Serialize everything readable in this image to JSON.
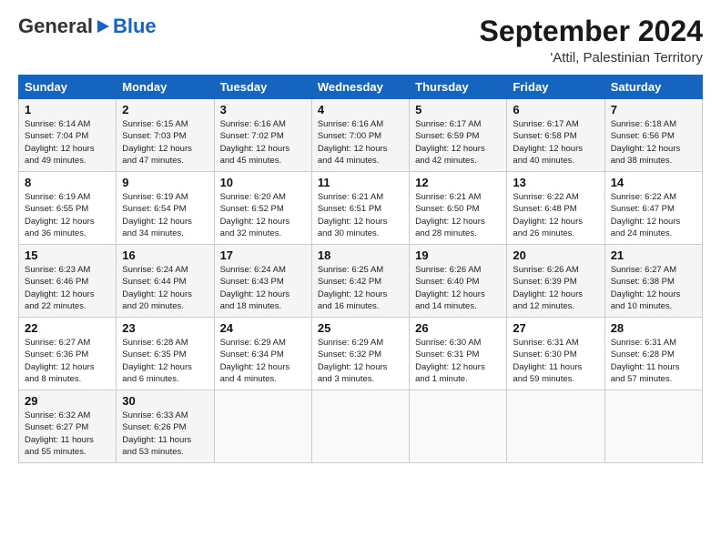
{
  "header": {
    "logo_general": "General",
    "logo_blue": "Blue",
    "month": "September 2024",
    "location": "'Attil, Palestinian Territory"
  },
  "days_of_week": [
    "Sunday",
    "Monday",
    "Tuesday",
    "Wednesday",
    "Thursday",
    "Friday",
    "Saturday"
  ],
  "weeks": [
    [
      {
        "day": "1",
        "info": "Sunrise: 6:14 AM\nSunset: 7:04 PM\nDaylight: 12 hours\nand 49 minutes."
      },
      {
        "day": "2",
        "info": "Sunrise: 6:15 AM\nSunset: 7:03 PM\nDaylight: 12 hours\nand 47 minutes."
      },
      {
        "day": "3",
        "info": "Sunrise: 6:16 AM\nSunset: 7:02 PM\nDaylight: 12 hours\nand 45 minutes."
      },
      {
        "day": "4",
        "info": "Sunrise: 6:16 AM\nSunset: 7:00 PM\nDaylight: 12 hours\nand 44 minutes."
      },
      {
        "day": "5",
        "info": "Sunrise: 6:17 AM\nSunset: 6:59 PM\nDaylight: 12 hours\nand 42 minutes."
      },
      {
        "day": "6",
        "info": "Sunrise: 6:17 AM\nSunset: 6:58 PM\nDaylight: 12 hours\nand 40 minutes."
      },
      {
        "day": "7",
        "info": "Sunrise: 6:18 AM\nSunset: 6:56 PM\nDaylight: 12 hours\nand 38 minutes."
      }
    ],
    [
      {
        "day": "8",
        "info": "Sunrise: 6:19 AM\nSunset: 6:55 PM\nDaylight: 12 hours\nand 36 minutes."
      },
      {
        "day": "9",
        "info": "Sunrise: 6:19 AM\nSunset: 6:54 PM\nDaylight: 12 hours\nand 34 minutes."
      },
      {
        "day": "10",
        "info": "Sunrise: 6:20 AM\nSunset: 6:52 PM\nDaylight: 12 hours\nand 32 minutes."
      },
      {
        "day": "11",
        "info": "Sunrise: 6:21 AM\nSunset: 6:51 PM\nDaylight: 12 hours\nand 30 minutes."
      },
      {
        "day": "12",
        "info": "Sunrise: 6:21 AM\nSunset: 6:50 PM\nDaylight: 12 hours\nand 28 minutes."
      },
      {
        "day": "13",
        "info": "Sunrise: 6:22 AM\nSunset: 6:48 PM\nDaylight: 12 hours\nand 26 minutes."
      },
      {
        "day": "14",
        "info": "Sunrise: 6:22 AM\nSunset: 6:47 PM\nDaylight: 12 hours\nand 24 minutes."
      }
    ],
    [
      {
        "day": "15",
        "info": "Sunrise: 6:23 AM\nSunset: 6:46 PM\nDaylight: 12 hours\nand 22 minutes."
      },
      {
        "day": "16",
        "info": "Sunrise: 6:24 AM\nSunset: 6:44 PM\nDaylight: 12 hours\nand 20 minutes."
      },
      {
        "day": "17",
        "info": "Sunrise: 6:24 AM\nSunset: 6:43 PM\nDaylight: 12 hours\nand 18 minutes."
      },
      {
        "day": "18",
        "info": "Sunrise: 6:25 AM\nSunset: 6:42 PM\nDaylight: 12 hours\nand 16 minutes."
      },
      {
        "day": "19",
        "info": "Sunrise: 6:26 AM\nSunset: 6:40 PM\nDaylight: 12 hours\nand 14 minutes."
      },
      {
        "day": "20",
        "info": "Sunrise: 6:26 AM\nSunset: 6:39 PM\nDaylight: 12 hours\nand 12 minutes."
      },
      {
        "day": "21",
        "info": "Sunrise: 6:27 AM\nSunset: 6:38 PM\nDaylight: 12 hours\nand 10 minutes."
      }
    ],
    [
      {
        "day": "22",
        "info": "Sunrise: 6:27 AM\nSunset: 6:36 PM\nDaylight: 12 hours\nand 8 minutes."
      },
      {
        "day": "23",
        "info": "Sunrise: 6:28 AM\nSunset: 6:35 PM\nDaylight: 12 hours\nand 6 minutes."
      },
      {
        "day": "24",
        "info": "Sunrise: 6:29 AM\nSunset: 6:34 PM\nDaylight: 12 hours\nand 4 minutes."
      },
      {
        "day": "25",
        "info": "Sunrise: 6:29 AM\nSunset: 6:32 PM\nDaylight: 12 hours\nand 3 minutes."
      },
      {
        "day": "26",
        "info": "Sunrise: 6:30 AM\nSunset: 6:31 PM\nDaylight: 12 hours\nand 1 minute."
      },
      {
        "day": "27",
        "info": "Sunrise: 6:31 AM\nSunset: 6:30 PM\nDaylight: 11 hours\nand 59 minutes."
      },
      {
        "day": "28",
        "info": "Sunrise: 6:31 AM\nSunset: 6:28 PM\nDaylight: 11 hours\nand 57 minutes."
      }
    ],
    [
      {
        "day": "29",
        "info": "Sunrise: 6:32 AM\nSunset: 6:27 PM\nDaylight: 11 hours\nand 55 minutes."
      },
      {
        "day": "30",
        "info": "Sunrise: 6:33 AM\nSunset: 6:26 PM\nDaylight: 11 hours\nand 53 minutes."
      },
      {
        "day": "",
        "info": ""
      },
      {
        "day": "",
        "info": ""
      },
      {
        "day": "",
        "info": ""
      },
      {
        "day": "",
        "info": ""
      },
      {
        "day": "",
        "info": ""
      }
    ]
  ]
}
